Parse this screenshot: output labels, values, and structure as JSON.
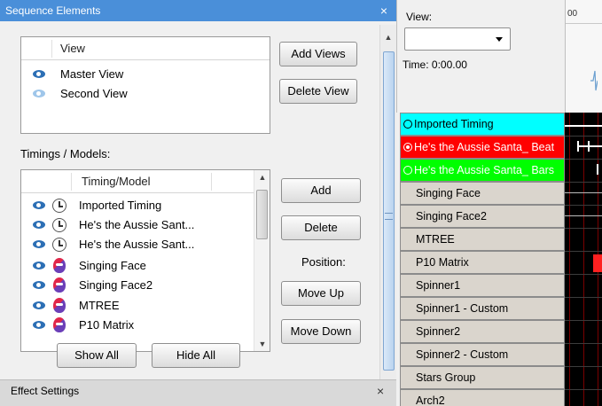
{
  "sequence_panel": {
    "title": "Sequence Elements",
    "close_glyph": "×"
  },
  "views": {
    "header": "View",
    "rows": [
      {
        "label": "Master View",
        "visible": true
      },
      {
        "label": "Second View",
        "visible": false
      }
    ],
    "add_button": "Add Views",
    "delete_button": "Delete View"
  },
  "timings": {
    "section_label": "Timings / Models:",
    "header": "Timing/Model",
    "rows": [
      {
        "label": "Imported Timing",
        "icon": "timing-clock-icon"
      },
      {
        "label": "He's the Aussie Sant...",
        "icon": "timing-clock-icon"
      },
      {
        "label": "He's the Aussie Sant...",
        "icon": "timing-clock-icon"
      },
      {
        "label": "Singing Face",
        "icon": "model-face-icon"
      },
      {
        "label": "Singing Face2",
        "icon": "model-face-icon"
      },
      {
        "label": "MTREE",
        "icon": "model-face-icon"
      },
      {
        "label": "P10 Matrix",
        "icon": "model-face-icon"
      }
    ],
    "add_button": "Add",
    "delete_button": "Delete",
    "position_label": "Position:",
    "move_up_button": "Move Up",
    "move_down_button": "Move Down",
    "show_all_button": "Show All",
    "hide_all_button": "Hide All"
  },
  "effect_settings": {
    "title": "Effect Settings",
    "close_glyph": "×"
  },
  "view_selector": {
    "label": "View:",
    "value": "",
    "time_label": "Time: 0:00.00"
  },
  "ruler": {
    "text": "00"
  },
  "row_headers": [
    {
      "label": "Imported Timing",
      "kind": "timing",
      "color": "#00ffff",
      "selected": false
    },
    {
      "label": "He's the Aussie Santa_ Beat",
      "kind": "timing",
      "color": "#ff0000",
      "selected": true
    },
    {
      "label": "He's the Aussie Santa_ Bars",
      "kind": "timing",
      "color": "#00ff00",
      "selected": false
    },
    {
      "label": "Singing Face",
      "kind": "model"
    },
    {
      "label": "Singing Face2",
      "kind": "model"
    },
    {
      "label": "MTREE",
      "kind": "model"
    },
    {
      "label": "P10 Matrix",
      "kind": "model"
    },
    {
      "label": "Spinner1",
      "kind": "model"
    },
    {
      "label": "Spinner1 - Custom",
      "kind": "model"
    },
    {
      "label": "Spinner2",
      "kind": "model"
    },
    {
      "label": "Spinner2 - Custom",
      "kind": "model"
    },
    {
      "label": "Stars Group",
      "kind": "model"
    },
    {
      "label": "Arch2",
      "kind": "model"
    }
  ],
  "colors": {
    "title_bar": "#4a8fd9",
    "grid_background": "#000000",
    "grid_line_red": "#8b0000",
    "effect_red": "#ff2020",
    "model_row": "#dad5cd"
  }
}
